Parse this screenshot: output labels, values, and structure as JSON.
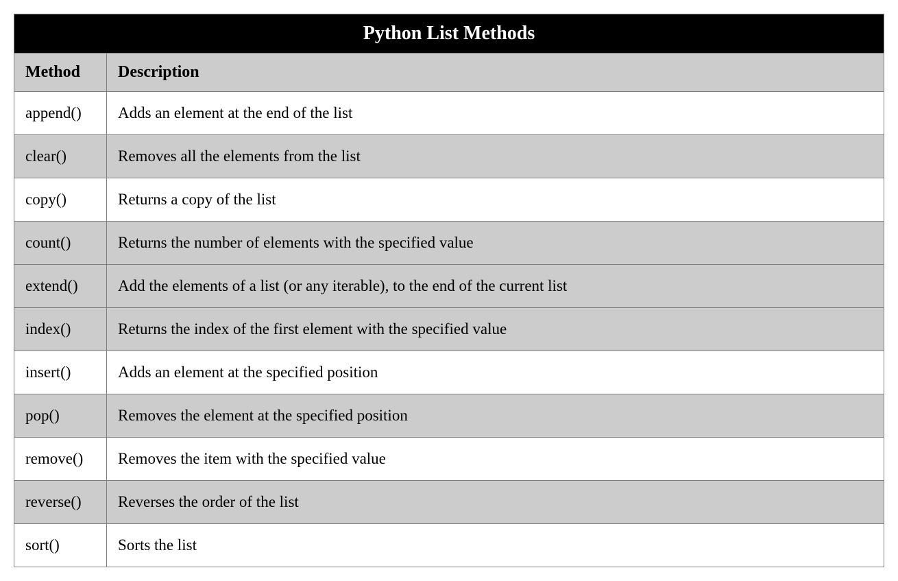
{
  "title": "Python List Methods",
  "headers": {
    "method": "Method",
    "description": "Description"
  },
  "rows": [
    {
      "method": "append()",
      "description": "Adds an element at the end of the list"
    },
    {
      "method": "clear()",
      "description": "Removes all the elements from the list"
    },
    {
      "method": "copy()",
      "description": "Returns a copy of the list"
    },
    {
      "method": "count()",
      "description": "Returns the number of elements with the specified value"
    },
    {
      "method": "extend()",
      "description": "Add the elements of a list (or any iterable), to the end of the current list"
    },
    {
      "method": "index()",
      "description": "Returns the index of the first element with the specified value"
    },
    {
      "method": "insert()",
      "description": "Adds an element at the specified position"
    },
    {
      "method": "pop()",
      "description": "Removes the element at the specified position"
    },
    {
      "method": "remove()",
      "description": "Removes the item with the specified value"
    },
    {
      "method": "reverse()",
      "description": "Reverses the order of the list"
    },
    {
      "method": "sort()",
      "description": "Sorts the list"
    }
  ]
}
